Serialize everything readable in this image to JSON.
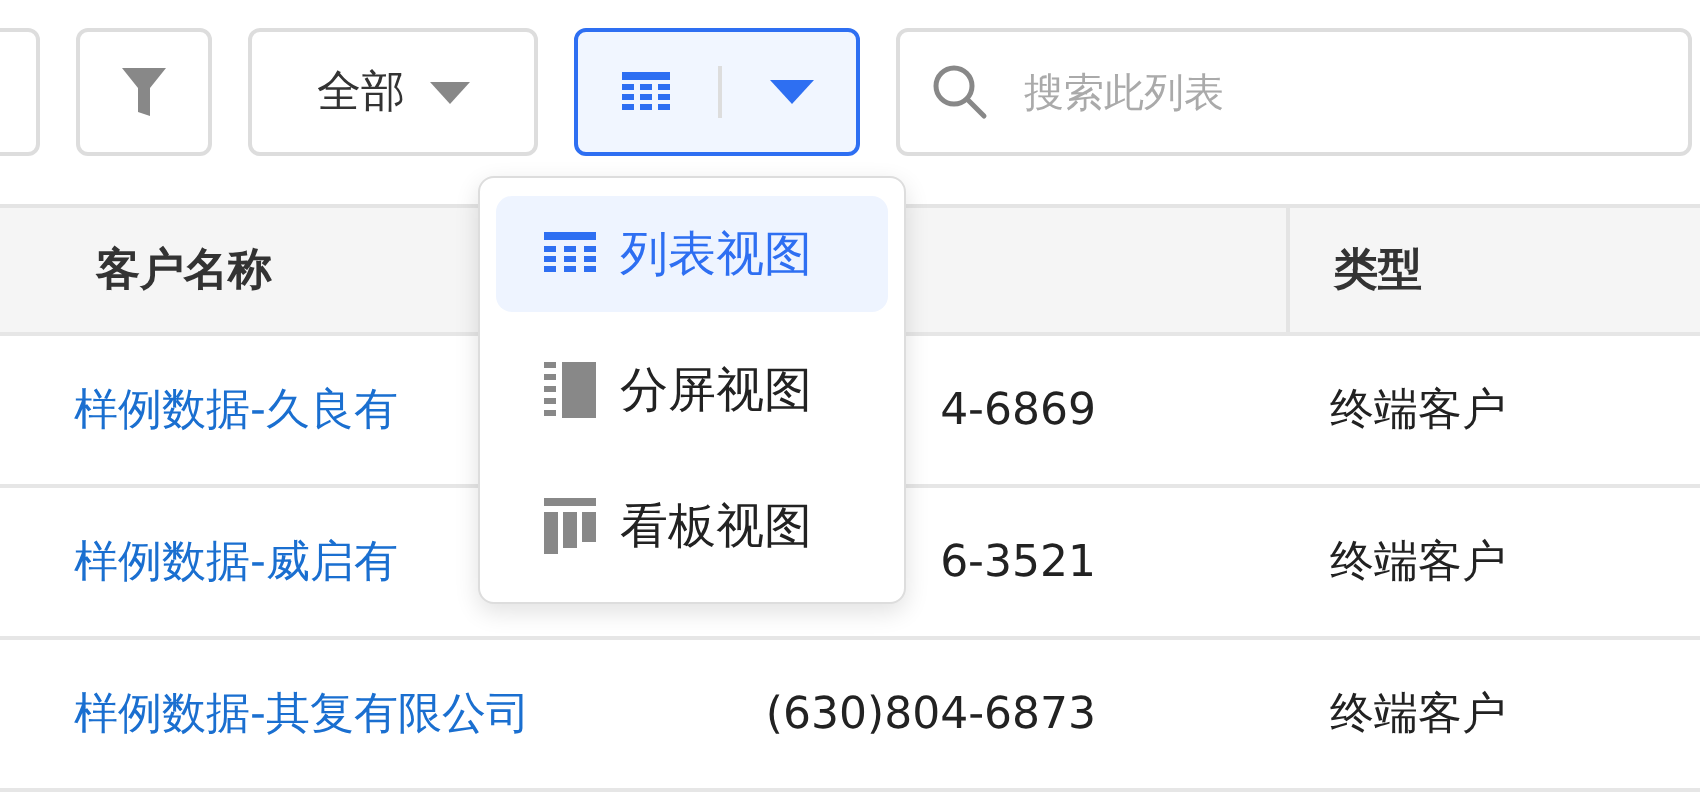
{
  "toolbar": {
    "scope_dropdown": {
      "label": "全部"
    },
    "view_switcher": {
      "open": true
    },
    "search": {
      "placeholder": "搜索此列表"
    }
  },
  "view_menu": [
    {
      "kind": "list",
      "label": "列表视图",
      "selected": true
    },
    {
      "kind": "split",
      "label": "分屏视图",
      "selected": false
    },
    {
      "kind": "kanban",
      "label": "看板视图",
      "selected": false
    }
  ],
  "table": {
    "columns": {
      "name": "客户名称",
      "type": "类型"
    },
    "rows": [
      {
        "name": "样例数据-久良有",
        "phone": "4-6869",
        "type": "终端客户"
      },
      {
        "name": "样例数据-威启有",
        "phone": "6-3521",
        "type": "终端客户"
      },
      {
        "name": "样例数据-其复有限公司",
        "phone": "(630)804-6873",
        "type": "终端客户"
      }
    ]
  }
}
